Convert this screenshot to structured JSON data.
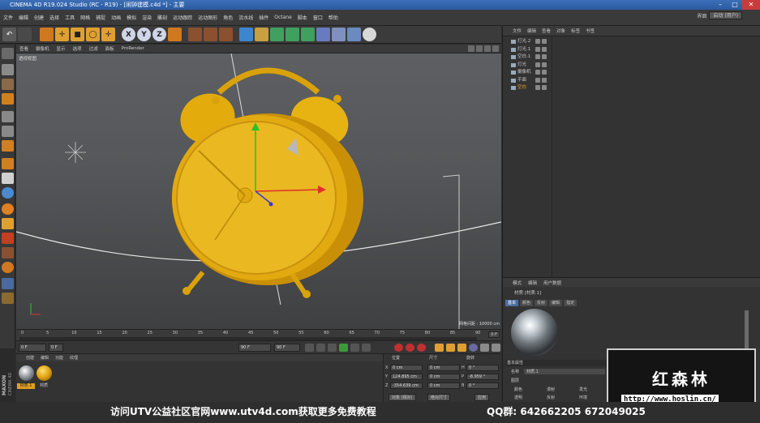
{
  "window": {
    "title": "CINEMA 4D R19.024 Studio (RC - R19) - [闹钟建模.c4d *] - 主要"
  },
  "menu": {
    "items": [
      "文件",
      "编辑",
      "创建",
      "选择",
      "工具",
      "网格",
      "捕捉",
      "动画",
      "模拟",
      "渲染",
      "雕刻",
      "运动跟踪",
      "运动图形",
      "角色",
      "流水线",
      "插件",
      "Octane",
      "脚本",
      "窗口",
      "帮助"
    ],
    "layout_label": "界面",
    "layout_value": "启动 (用户)"
  },
  "viewport": {
    "menu": [
      "查看",
      "摄像机",
      "显示",
      "选项",
      "过滤",
      "面板",
      "ProRender"
    ],
    "label": "透视视图",
    "grid_spacing": "网格间距 : 10000 cm"
  },
  "timeline": {
    "ticks": [
      "0",
      "5",
      "10",
      "15",
      "20",
      "25",
      "30",
      "35",
      "40",
      "45",
      "50",
      "55",
      "60",
      "65",
      "70",
      "75",
      "80",
      "85",
      "90"
    ],
    "end_frame": "0 F"
  },
  "playback": {
    "current": "0 F",
    "start": "0 F",
    "end": "90 F",
    "end2": "90 F"
  },
  "material_manager": {
    "menu": [
      "创建",
      "编辑",
      "功能",
      "纹理"
    ],
    "materials": [
      {
        "name": "材质.1"
      },
      {
        "name": "材质"
      }
    ]
  },
  "coordinates": {
    "headers": [
      "位置",
      "尺寸",
      "旋转"
    ],
    "rows": [
      {
        "axis": "X",
        "pos": "0 cm",
        "size": "0 cm",
        "rlabel": "H",
        "rot": "0 °"
      },
      {
        "axis": "Y",
        "pos": "124.895 cm",
        "size": "0 cm",
        "rlabel": "P",
        "rot": "-8.959 °"
      },
      {
        "axis": "Z",
        "pos": "-354.639 cm",
        "size": "0 cm",
        "rlabel": "B",
        "rot": "0 °"
      }
    ],
    "mode": "对象 (相对)",
    "size_mode": "绝对尺寸",
    "apply": "应用"
  },
  "object_manager": {
    "tabs": [
      "文件",
      "编辑",
      "查看",
      "对象",
      "标签",
      "书签"
    ],
    "objects": [
      {
        "name": "灯光.2"
      },
      {
        "name": "灯光.1"
      },
      {
        "name": "空白.1"
      },
      {
        "name": "灯光"
      },
      {
        "name": "摄像机"
      },
      {
        "name": "平面"
      },
      {
        "name": "空白"
      }
    ]
  },
  "attribute_manager": {
    "tabs": [
      "模式",
      "编辑",
      "用户数据"
    ],
    "title": "材质 [材质.1]",
    "subtabs": [
      "基本",
      "颜色",
      "反射",
      "编辑",
      "指定"
    ],
    "section": "基本属性",
    "fields": [
      {
        "label": "名称",
        "value": "材质.1"
      },
      {
        "label": "图层",
        "value": ""
      }
    ],
    "channels": [
      {
        "label": "颜色"
      },
      {
        "label": "漫射"
      },
      {
        "label": "发光"
      },
      {
        "label": "透明"
      },
      {
        "label": "反射"
      },
      {
        "label": "环境"
      }
    ]
  },
  "watermark": {
    "title": "红森林",
    "url": "http://www.hoslin.cn/"
  },
  "caption": {
    "text": "访问UTV公益社区官网www.utv4d.com获取更多免费教程",
    "qq": "QQ群: 642662205  672049025"
  },
  "branding": {
    "maxon": "MAXON",
    "cinema": "CINEMA 4D"
  },
  "colors": {
    "clock": "#e8b10f",
    "accent": "#4c6ea0"
  }
}
